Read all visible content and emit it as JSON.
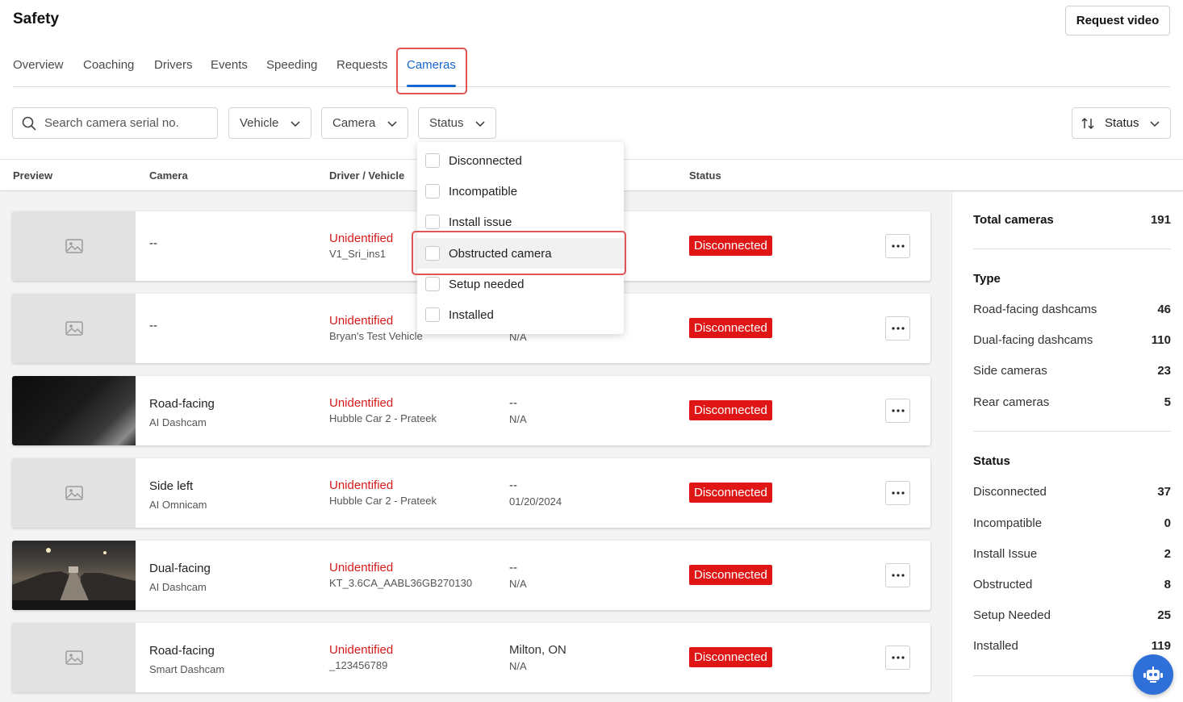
{
  "app": {
    "title": "Safety",
    "request_video": "Request video"
  },
  "tabs": [
    {
      "label": "Overview"
    },
    {
      "label": "Coaching"
    },
    {
      "label": "Drivers"
    },
    {
      "label": "Events"
    },
    {
      "label": "Speeding"
    },
    {
      "label": "Requests"
    },
    {
      "label": "Cameras",
      "active": true
    }
  ],
  "filters": {
    "search_placeholder": "Search camera serial no.",
    "vehicle": "Vehicle",
    "camera": "Camera",
    "status": "Status",
    "sort": "Status"
  },
  "table": {
    "headers": {
      "preview": "Preview",
      "camera": "Camera",
      "driver_vehicle": "Driver / Vehicle",
      "status": "Status"
    },
    "rows": [
      {
        "camera": "--",
        "camera_type": "",
        "driver": "Unidentified",
        "vehicle": "V1_Sri_ins1",
        "location": "",
        "date": "",
        "status": "Disconnected",
        "preview": "placeholder"
      },
      {
        "camera": "--",
        "camera_type": "",
        "driver": "Unidentified",
        "vehicle": "Bryan's Test Vehicle",
        "location": "",
        "date": "N/A",
        "status": "Disconnected",
        "preview": "placeholder"
      },
      {
        "camera": "Road-facing",
        "camera_type": "AI Dashcam",
        "driver": "Unidentified",
        "vehicle": "Hubble Car 2 - Prateek",
        "location": "--",
        "date": "N/A",
        "status": "Disconnected",
        "preview": "dark"
      },
      {
        "camera": "Side left",
        "camera_type": "AI Omnicam",
        "driver": "Unidentified",
        "vehicle": "Hubble Car 2 - Prateek",
        "location": "--",
        "date": "01/20/2024",
        "status": "Disconnected",
        "preview": "placeholder"
      },
      {
        "camera": "Dual-facing",
        "camera_type": "AI Dashcam",
        "driver": "Unidentified",
        "vehicle": "KT_3.6CA_AABL36GB270130",
        "location": "--",
        "date": "N/A",
        "status": "Disconnected",
        "preview": "night"
      },
      {
        "camera": "Road-facing",
        "camera_type": "Smart Dashcam",
        "driver": "Unidentified",
        "vehicle": "_123456789",
        "location": "Milton, ON",
        "date": "N/A",
        "status": "Disconnected",
        "preview": "placeholder"
      }
    ]
  },
  "status_dropdown": {
    "options": [
      {
        "label": "Disconnected"
      },
      {
        "label": "Incompatible"
      },
      {
        "label": "Install issue"
      },
      {
        "label": "Obstructed camera",
        "highlighted": true
      },
      {
        "label": "Setup needed"
      },
      {
        "label": "Installed"
      }
    ]
  },
  "summary": {
    "total_label": "Total cameras",
    "total_value": "191",
    "type_heading": "Type",
    "types": [
      {
        "label": "Road-facing dashcams",
        "value": "46"
      },
      {
        "label": "Dual-facing dashcams",
        "value": "110"
      },
      {
        "label": "Side cameras",
        "value": "23"
      },
      {
        "label": "Rear cameras",
        "value": "5"
      }
    ],
    "status_heading": "Status",
    "statuses": [
      {
        "label": "Disconnected",
        "value": "37"
      },
      {
        "label": "Incompatible",
        "value": "0"
      },
      {
        "label": "Install Issue",
        "value": "2"
      },
      {
        "label": "Obstructed",
        "value": "8"
      },
      {
        "label": "Setup Needed",
        "value": "25"
      },
      {
        "label": "Installed",
        "value": "119"
      }
    ]
  },
  "colors": {
    "accent": "#1765d0",
    "danger": "#e01515",
    "driver_text": "#d61a1a",
    "highlight_box": "#e05656",
    "fab": "#2f6fd8"
  }
}
